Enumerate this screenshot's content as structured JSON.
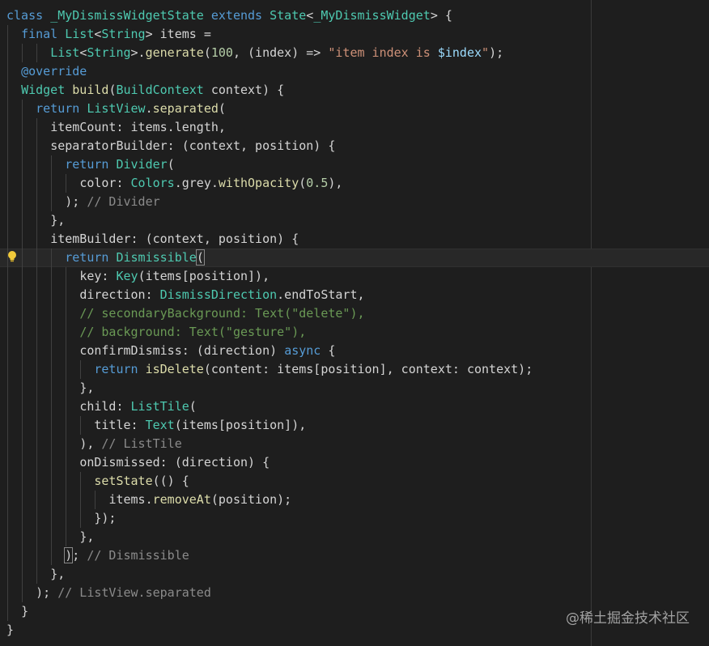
{
  "colors": {
    "background": "#1e1e1e",
    "plain": "#d4d4d4",
    "keyword": "#569cd6",
    "type": "#4ec9b0",
    "function": "#dcdcaa",
    "string": "#ce9178",
    "number": "#b5cea8",
    "comment_decl": "#8b8b8b",
    "comment_code": "#6a9955",
    "interpolation": "#9cdcfe"
  },
  "icons": {
    "lightbulb": "lightbulb-icon"
  },
  "watermark": "@稀土掘金技术社区",
  "code_lines": [
    {
      "indent": 0,
      "active": false,
      "tokens": [
        {
          "t": "class ",
          "c": "keyword"
        },
        {
          "t": "_MyDismissWidgetState",
          "c": "type"
        },
        {
          "t": " extends ",
          "c": "keyword"
        },
        {
          "t": "State",
          "c": "type"
        },
        {
          "t": "<",
          "c": "plain"
        },
        {
          "t": "_MyDismissWidget",
          "c": "type"
        },
        {
          "t": "> {",
          "c": "plain"
        }
      ]
    },
    {
      "indent": 1,
      "active": false,
      "tokens": [
        {
          "t": "final ",
          "c": "keyword"
        },
        {
          "t": "List",
          "c": "type"
        },
        {
          "t": "<",
          "c": "plain"
        },
        {
          "t": "String",
          "c": "type"
        },
        {
          "t": "> items =",
          "c": "plain"
        }
      ]
    },
    {
      "indent": 3,
      "active": false,
      "tokens": [
        {
          "t": "List",
          "c": "type"
        },
        {
          "t": "<",
          "c": "plain"
        },
        {
          "t": "String",
          "c": "type"
        },
        {
          "t": ">.",
          "c": "plain"
        },
        {
          "t": "generate",
          "c": "function"
        },
        {
          "t": "(",
          "c": "plain"
        },
        {
          "t": "100",
          "c": "number"
        },
        {
          "t": ", (index) => ",
          "c": "plain"
        },
        {
          "t": "\"item index is ",
          "c": "string"
        },
        {
          "t": "$index",
          "c": "interpolation"
        },
        {
          "t": "\"",
          "c": "string"
        },
        {
          "t": ");",
          "c": "plain"
        }
      ]
    },
    {
      "indent": 1,
      "active": false,
      "tokens": [
        {
          "t": "@override",
          "c": "keyword"
        }
      ]
    },
    {
      "indent": 1,
      "active": false,
      "tokens": [
        {
          "t": "Widget",
          "c": "type"
        },
        {
          "t": " ",
          "c": "plain"
        },
        {
          "t": "build",
          "c": "function"
        },
        {
          "t": "(",
          "c": "plain"
        },
        {
          "t": "BuildContext",
          "c": "type"
        },
        {
          "t": " context) {",
          "c": "plain"
        }
      ]
    },
    {
      "indent": 2,
      "active": false,
      "tokens": [
        {
          "t": "return ",
          "c": "keyword"
        },
        {
          "t": "ListView",
          "c": "type"
        },
        {
          "t": ".",
          "c": "plain"
        },
        {
          "t": "separated",
          "c": "function"
        },
        {
          "t": "(",
          "c": "plain"
        }
      ]
    },
    {
      "indent": 3,
      "active": false,
      "tokens": [
        {
          "t": "itemCount: items.length,",
          "c": "plain"
        }
      ]
    },
    {
      "indent": 3,
      "active": false,
      "tokens": [
        {
          "t": "separatorBuilder: (context, position) {",
          "c": "plain"
        }
      ]
    },
    {
      "indent": 4,
      "active": false,
      "tokens": [
        {
          "t": "return ",
          "c": "keyword"
        },
        {
          "t": "Divider",
          "c": "type"
        },
        {
          "t": "(",
          "c": "plain"
        }
      ]
    },
    {
      "indent": 5,
      "active": false,
      "tokens": [
        {
          "t": "color: ",
          "c": "plain"
        },
        {
          "t": "Colors",
          "c": "type"
        },
        {
          "t": ".grey.",
          "c": "plain"
        },
        {
          "t": "withOpacity",
          "c": "function"
        },
        {
          "t": "(",
          "c": "plain"
        },
        {
          "t": "0.5",
          "c": "number"
        },
        {
          "t": "),",
          "c": "plain"
        }
      ]
    },
    {
      "indent": 4,
      "active": false,
      "tokens": [
        {
          "t": "); ",
          "c": "plain"
        },
        {
          "t": "// Divider",
          "c": "comment_decl"
        }
      ]
    },
    {
      "indent": 3,
      "active": false,
      "tokens": [
        {
          "t": "},",
          "c": "plain"
        }
      ]
    },
    {
      "indent": 3,
      "active": false,
      "tokens": [
        {
          "t": "itemBuilder: (context, position) {",
          "c": "plain"
        }
      ]
    },
    {
      "indent": 4,
      "active": true,
      "tokens": [
        {
          "t": "return ",
          "c": "keyword"
        },
        {
          "t": "Dismissible",
          "c": "type"
        },
        {
          "t": "(",
          "c": "plain",
          "hl": true
        }
      ]
    },
    {
      "indent": 5,
      "active": false,
      "tokens": [
        {
          "t": "key: ",
          "c": "plain"
        },
        {
          "t": "Key",
          "c": "type"
        },
        {
          "t": "(items[position]),",
          "c": "plain"
        }
      ]
    },
    {
      "indent": 5,
      "active": false,
      "tokens": [
        {
          "t": "direction: ",
          "c": "plain"
        },
        {
          "t": "DismissDirection",
          "c": "type"
        },
        {
          "t": ".endToStart,",
          "c": "plain"
        }
      ]
    },
    {
      "indent": 5,
      "active": false,
      "tokens": [
        {
          "t": "// secondaryBackground: Text(\"delete\"),",
          "c": "comment_code"
        }
      ]
    },
    {
      "indent": 5,
      "active": false,
      "tokens": [
        {
          "t": "// background: Text(\"gesture\"),",
          "c": "comment_code"
        }
      ]
    },
    {
      "indent": 5,
      "active": false,
      "tokens": [
        {
          "t": "confirmDismiss: (direction) ",
          "c": "plain"
        },
        {
          "t": "async",
          "c": "keyword"
        },
        {
          "t": " {",
          "c": "plain"
        }
      ]
    },
    {
      "indent": 6,
      "active": false,
      "tokens": [
        {
          "t": "return ",
          "c": "keyword"
        },
        {
          "t": "isDelete",
          "c": "function"
        },
        {
          "t": "(content: items[position], context: context);",
          "c": "plain"
        }
      ]
    },
    {
      "indent": 5,
      "active": false,
      "tokens": [
        {
          "t": "},",
          "c": "plain"
        }
      ]
    },
    {
      "indent": 5,
      "active": false,
      "tokens": [
        {
          "t": "child: ",
          "c": "plain"
        },
        {
          "t": "ListTile",
          "c": "type"
        },
        {
          "t": "(",
          "c": "plain"
        }
      ]
    },
    {
      "indent": 6,
      "active": false,
      "tokens": [
        {
          "t": "title: ",
          "c": "plain"
        },
        {
          "t": "Text",
          "c": "type"
        },
        {
          "t": "(items[position]),",
          "c": "plain"
        }
      ]
    },
    {
      "indent": 5,
      "active": false,
      "tokens": [
        {
          "t": "), ",
          "c": "plain"
        },
        {
          "t": "// ListTile",
          "c": "comment_decl"
        }
      ]
    },
    {
      "indent": 5,
      "active": false,
      "tokens": [
        {
          "t": "onDismissed: (direction) {",
          "c": "plain"
        }
      ]
    },
    {
      "indent": 6,
      "active": false,
      "tokens": [
        {
          "t": "setState",
          "c": "function"
        },
        {
          "t": "(() {",
          "c": "plain"
        }
      ]
    },
    {
      "indent": 7,
      "active": false,
      "tokens": [
        {
          "t": "items.",
          "c": "plain"
        },
        {
          "t": "removeAt",
          "c": "function"
        },
        {
          "t": "(position);",
          "c": "plain"
        }
      ]
    },
    {
      "indent": 6,
      "active": false,
      "tokens": [
        {
          "t": "});",
          "c": "plain"
        }
      ]
    },
    {
      "indent": 5,
      "active": false,
      "tokens": [
        {
          "t": "},",
          "c": "plain"
        }
      ]
    },
    {
      "indent": 4,
      "active": false,
      "tokens": [
        {
          "t": ")",
          "c": "plain",
          "hl": true
        },
        {
          "t": "; ",
          "c": "plain"
        },
        {
          "t": "// Dismissible",
          "c": "comment_decl"
        }
      ]
    },
    {
      "indent": 3,
      "active": false,
      "tokens": [
        {
          "t": "},",
          "c": "plain"
        }
      ]
    },
    {
      "indent": 2,
      "active": false,
      "tokens": [
        {
          "t": "); ",
          "c": "plain"
        },
        {
          "t": "// ListView.separated",
          "c": "comment_decl"
        }
      ]
    },
    {
      "indent": 1,
      "active": false,
      "tokens": [
        {
          "t": "}",
          "c": "plain"
        }
      ]
    },
    {
      "indent": 0,
      "active": false,
      "tokens": [
        {
          "t": "}",
          "c": "plain"
        }
      ]
    }
  ]
}
